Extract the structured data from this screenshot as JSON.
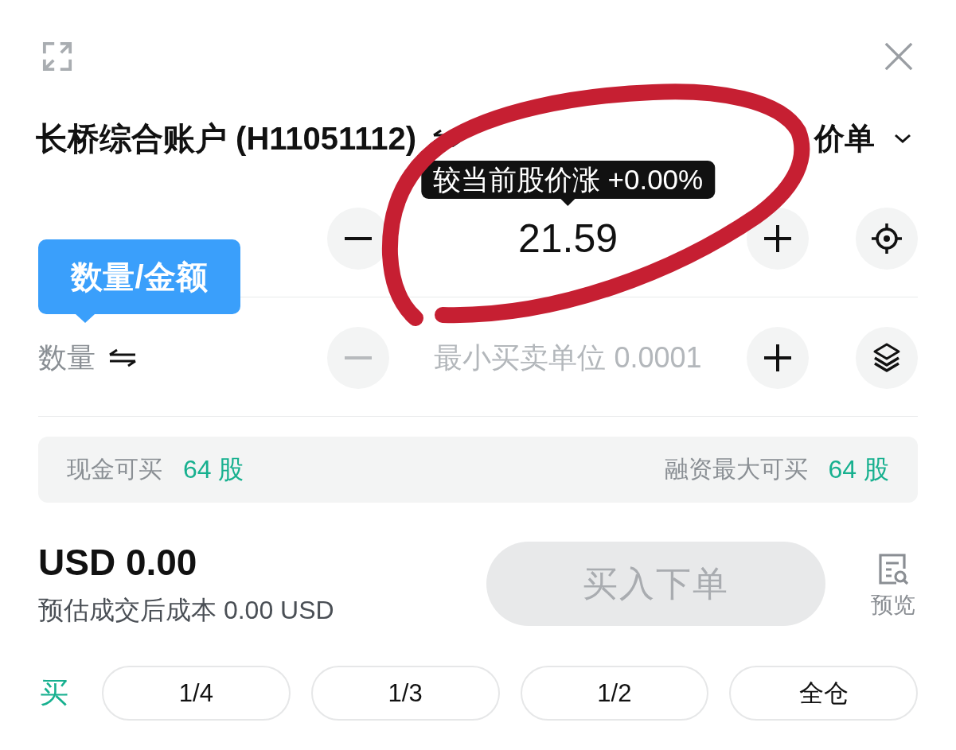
{
  "account": {
    "title": "长桥综合账户 (H11051112)"
  },
  "order_type": {
    "label": "价单"
  },
  "price_row": {
    "value": "21.59",
    "change_tooltip": "较当前股价涨 +0.00%",
    "minus_disabled": false,
    "plus_disabled": false
  },
  "mode_popover": {
    "text": "数量/金额"
  },
  "quantity_row": {
    "label": "数量",
    "placeholder": "最小买卖单位 0.0001",
    "minus_disabled": true,
    "plus_disabled": false
  },
  "buying_power": [
    {
      "label": "现金可买",
      "value": "64 股"
    },
    {
      "label": "融资最大可买",
      "value": "64 股"
    }
  ],
  "summary": {
    "amount": "USD 0.00",
    "estimate": "预估成交后成本 0.00 USD"
  },
  "submit_button": {
    "label": "买入下单",
    "disabled": true
  },
  "preview": {
    "label": "预览"
  },
  "quick_fill": {
    "side": "买",
    "options": [
      {
        "label": "1/4",
        "selected": false
      },
      {
        "label": "1/3",
        "selected": false
      },
      {
        "label": "1/2",
        "selected": false
      },
      {
        "label": "全仓",
        "selected": false
      }
    ]
  },
  "annotations": [
    {
      "kind": "freehand_loop"
    }
  ]
}
